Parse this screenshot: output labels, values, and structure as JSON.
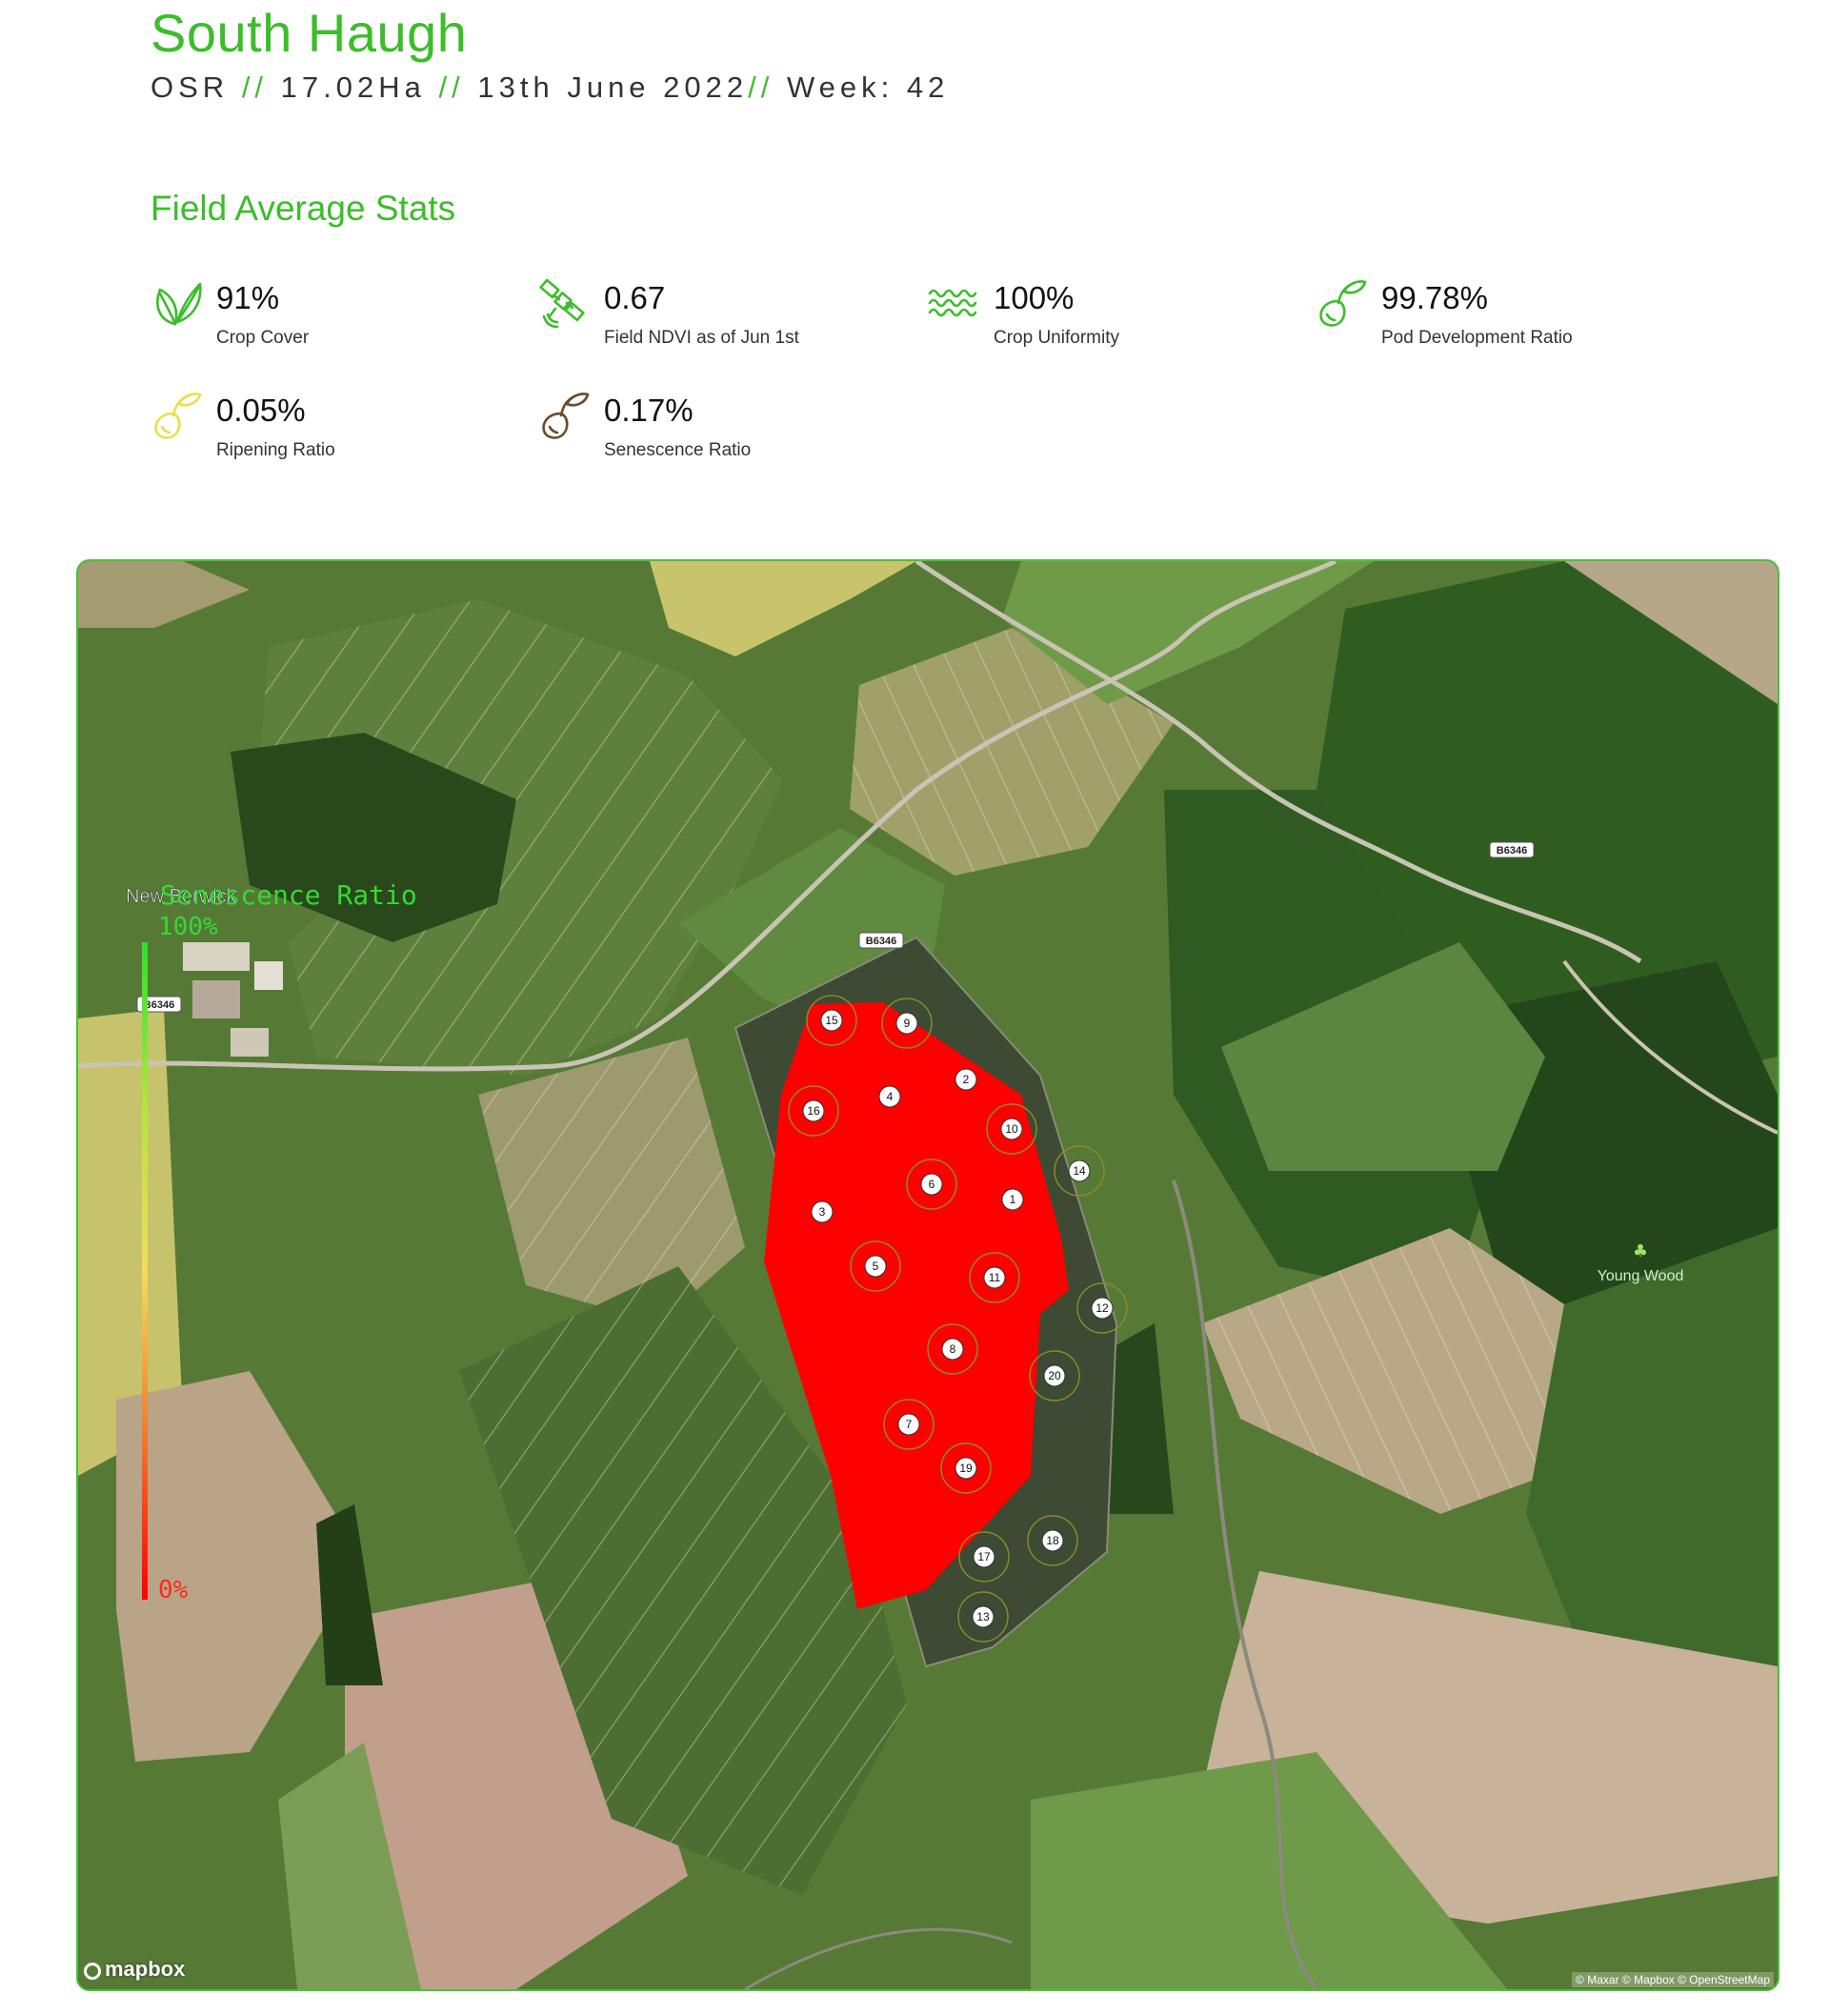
{
  "header": {
    "title": "South Haugh",
    "crop": "OSR",
    "separator": "//",
    "area": "17.02Ha",
    "date": "13th June 2022",
    "week": "Week: 42"
  },
  "stats_section": {
    "title": "Field Average Stats",
    "stats": [
      {
        "value": "91%",
        "label": "Crop Cover",
        "icon": "leaf-icon",
        "color": "#3cbd2a"
      },
      {
        "value": "0.67",
        "label": "Field NDVI as of Jun 1st",
        "icon": "satellite-icon",
        "color": "#3cbd2a"
      },
      {
        "value": "100%",
        "label": "Crop Uniformity",
        "icon": "waves-icon",
        "color": "#3cbd2a"
      },
      {
        "value": "99.78%",
        "label": "Pod Development Ratio",
        "icon": "pod-sprout-icon",
        "color": "#3cbd2a"
      },
      {
        "value": "0.05%",
        "label": "Ripening Ratio",
        "icon": "ripening-sprout-icon",
        "color": "#e7e14a"
      },
      {
        "value": "0.17%",
        "label": "Senescence Ratio",
        "icon": "senescence-sprout-icon",
        "color": "#6b4a2b"
      }
    ]
  },
  "map": {
    "legend": {
      "title": "Senescence Ratio",
      "max_label": "100%",
      "min_label": "0%",
      "gradient": [
        "#ff0000",
        "#f07a30",
        "#f2dc5a",
        "#b5e43f",
        "#2ee02e"
      ]
    },
    "place_labels": {
      "town": "New Berwick",
      "wood": "Young Wood"
    },
    "road_labels": [
      "B6346",
      "B6346",
      "B6346"
    ],
    "field_color": "#ff0000",
    "sample_points": [
      "15",
      "9",
      "2",
      "4",
      "16",
      "10",
      "14",
      "6",
      "1",
      "3",
      "5",
      "11",
      "12",
      "8",
      "20",
      "7",
      "19",
      "17",
      "18",
      "13"
    ],
    "logo": "mapbox",
    "attribution": "© Maxar © Mapbox © OpenStreetMap"
  }
}
